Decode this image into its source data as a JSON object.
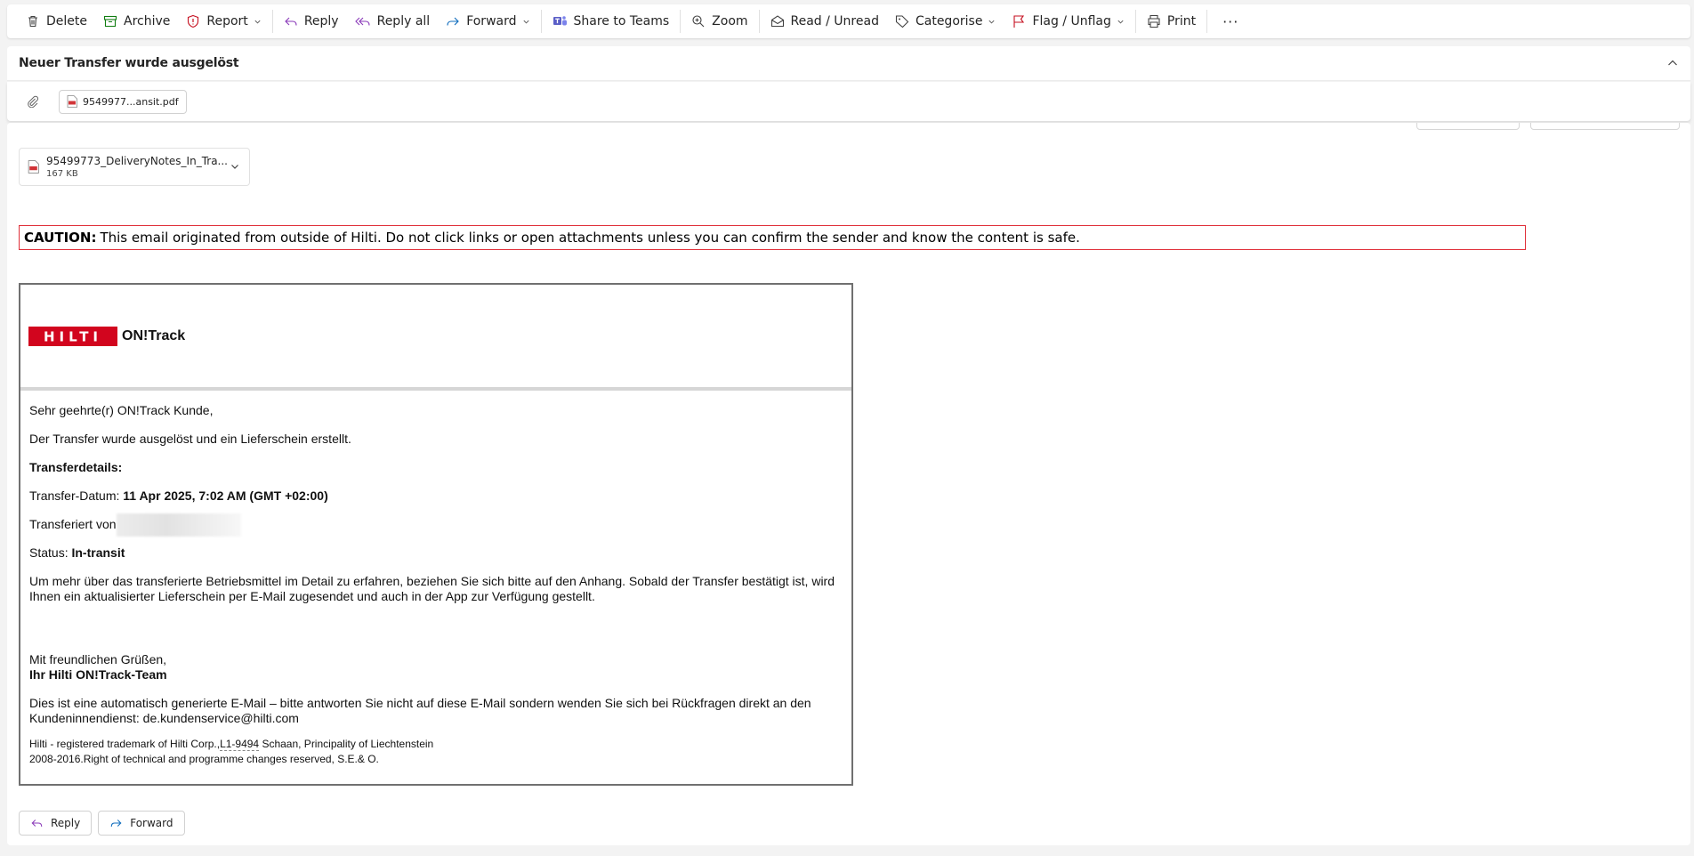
{
  "toolbar": {
    "delete": "Delete",
    "archive": "Archive",
    "report": "Report",
    "reply": "Reply",
    "reply_all": "Reply all",
    "forward": "Forward",
    "share_teams": "Share to Teams",
    "zoom": "Zoom",
    "read_unread": "Read / Unread",
    "categorise": "Categorise",
    "flag": "Flag / Unflag",
    "print": "Print",
    "more": "···"
  },
  "message": {
    "subject": "Neuer Transfer wurde ausgelöst",
    "attachment_chip": "9549977...ansit.pdf",
    "attachment_name": "95499773_DeliveryNotes_In_Tra...",
    "attachment_size": "167 KB"
  },
  "caution": {
    "label": "CAUTION:",
    "text": "This email originated from outside of Hilti. Do not click links or open attachments unless you can confirm the sender and know the content is safe."
  },
  "email": {
    "logo_text": "HILTI",
    "brand": "ON!Track",
    "greeting": "Sehr geehrte(r) ON!Track Kunde,",
    "intro": "Der Transfer wurde ausgelöst und ein Lieferschein erstellt.",
    "details_heading": "Transferdetails:",
    "date_label": "Transfer-Datum:",
    "date_value": "11 Apr 2025, 7:02 AM (GMT +02:00)",
    "from_label": "Transferiert von",
    "status_label": "Status:",
    "status_value": "In-transit",
    "info": "Um mehr über das transferierte Betriebsmittel im Detail zu erfahren, beziehen Sie sich bitte auf den Anhang. Sobald der Transfer bestätigt ist, wird Ihnen ein aktualisierter Lieferschein per E-Mail zugesendet und auch in der App zur Verfügung gestellt.",
    "closing": "Mit freundlichen Grüßen,",
    "team": "Ihr Hilti ON!Track-Team",
    "auto_notice": "Dies ist eine automatisch generierte E-Mail – bitte antworten Sie nicht auf diese E-Mail sondern wenden Sie sich bei Rückfragen direkt an den Kundeninnendienst: de.kundenservice@hilti.com",
    "footer_a": "Hilti - registered trademark of Hilti Corp.,",
    "footer_code": "L1-9494",
    "footer_b": " Schaan, Principality of Liechtenstein",
    "footer_line2": "2008-2016.Right of technical and programme changes reserved, S.E.& O."
  },
  "actions": {
    "reply": "Reply",
    "forward": "Forward"
  },
  "colors": {
    "hilti_red": "#d2051e",
    "caution_border": "#e0303a",
    "teams_purple": "#5b5fc7",
    "archive_green": "#107c10",
    "report_red": "#c50f1f",
    "reply_purple": "#8a3ab9",
    "forward_blue": "#0f6cbd"
  },
  "icons": [
    "trash-icon",
    "archive-icon",
    "report-icon",
    "reply-icon",
    "reply-all-icon",
    "forward-icon",
    "teams-icon",
    "zoom-icon",
    "envelope-icon",
    "tag-icon",
    "flag-icon",
    "print-icon",
    "chevron-up-icon",
    "paperclip-icon",
    "pdf-icon",
    "chevron-down-icon"
  ]
}
